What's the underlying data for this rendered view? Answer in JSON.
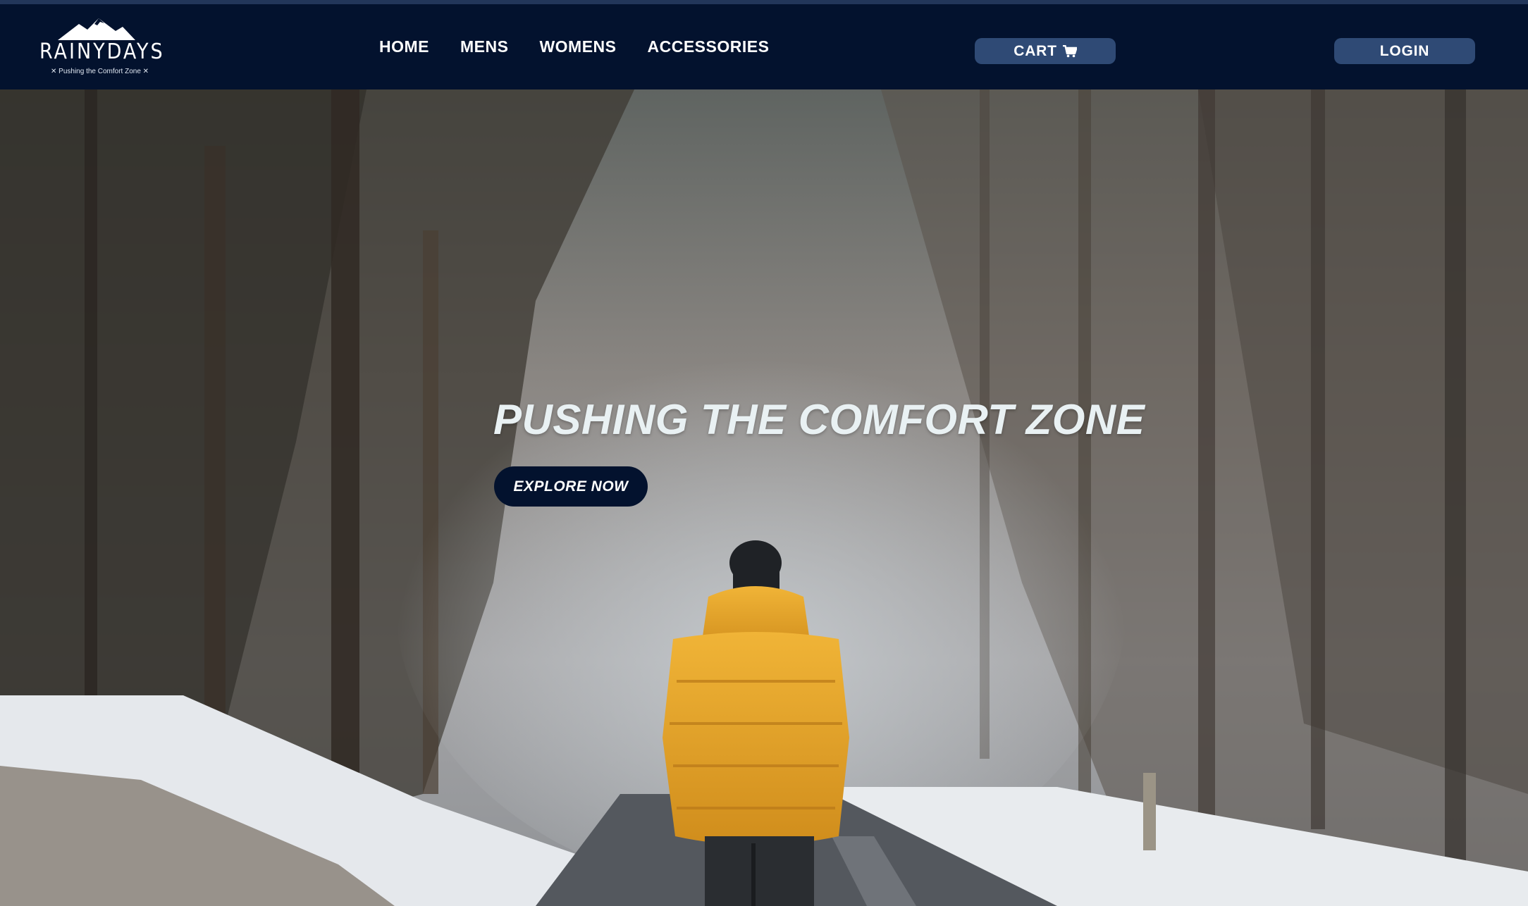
{
  "brand": {
    "name": "RAINYDAYS",
    "tagline": "✕ Pushing the Comfort Zone ✕"
  },
  "nav": {
    "items": [
      {
        "label": "HOME"
      },
      {
        "label": "MENS"
      },
      {
        "label": "WOMENS"
      },
      {
        "label": "ACCESSORIES"
      }
    ]
  },
  "header_actions": {
    "cart_label": "CART",
    "cart_icon": "shopping-cart-icon",
    "login_label": "LOGIN"
  },
  "hero": {
    "headline": "PUSHING THE COMFORT ZONE",
    "cta_label": "EXPLORE NOW"
  },
  "colors": {
    "header_bg": "#03122e",
    "pill_bg": "#2f4a75",
    "jacket": "#e4a52b"
  }
}
